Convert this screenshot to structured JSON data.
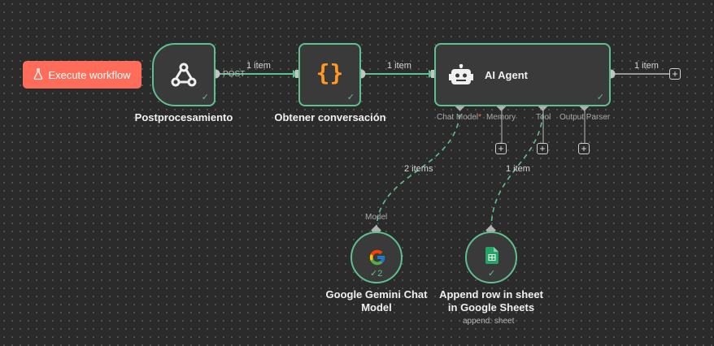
{
  "toolbar": {
    "execute_label": "Execute workflow"
  },
  "nodes": {
    "webhook": {
      "name": "Postprocesamiento",
      "output_label": "POST"
    },
    "code": {
      "name": "Obtener conversación"
    },
    "agent": {
      "name": "AI Agent",
      "ports": {
        "chat_model": "Chat Model",
        "chat_model_required": "*",
        "memory": "Memory",
        "tool": "Tool",
        "output_parser": "Output Parser"
      }
    },
    "gemini": {
      "name_line1": "Google Gemini Chat",
      "name_line2": "Model",
      "port_label": "Model",
      "run_count": "2"
    },
    "sheets": {
      "name_line1": "Append row in sheet",
      "name_line2": "in Google Sheets",
      "subtitle": "append: sheet"
    }
  },
  "edges": {
    "webhook_to_code": "1 item",
    "code_to_agent": "1 item",
    "agent_out": "1 item",
    "gemini_to_agent": "2 items",
    "sheets_to_agent": "1 item"
  },
  "colors": {
    "canvas": "#2b2b2b",
    "node_border_success": "#5fbf8f",
    "accent": "#ff6d5a",
    "code_icon": "#ff9922",
    "sheets_icon": "#23a566"
  },
  "icons": {
    "execute": "flask-icon",
    "webhook": "webhook-icon",
    "code": "curly-braces-icon",
    "agent": "robot-icon",
    "gemini": "google-g-icon",
    "sheets": "google-sheets-icon",
    "success": "check-icon",
    "add": "plus-icon"
  }
}
